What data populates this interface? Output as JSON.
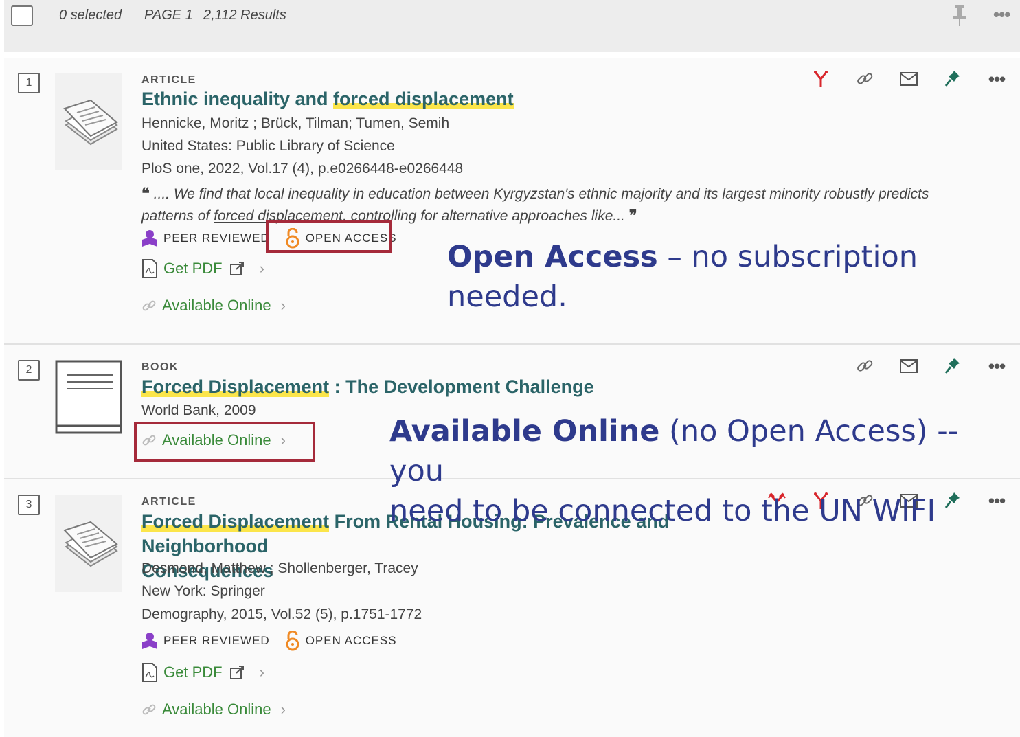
{
  "toolbar": {
    "selected": "0 selected",
    "page": "PAGE 1",
    "results": "2,112 Results"
  },
  "records": [
    {
      "num": "1",
      "type": "ARTICLE",
      "title_hl": "forced displacement",
      "title_plain": "Ethnic inequality and ",
      "authors": "Hennicke, Moritz ; Brück, Tilman; Tumen, Semih",
      "publisher": "United States: Public Library of Science",
      "source": "PloS one, 2022, Vol.17 (4), p.e0266448-e0266448",
      "snippet_a": " .... We find that local inequality in education between Kyrgyzstan's ethnic majority and its largest minority robustly predicts patterns of ",
      "snippet_hl": "forced displacement",
      "snippet_b": ", controlling for alternative approaches like... ",
      "peer": "PEER REVIEWED",
      "oa": "OPEN ACCESS",
      "pdf": "Get PDF",
      "online": "Available Online"
    },
    {
      "num": "2",
      "type": "BOOK",
      "title_hl": "Forced Displacement",
      "title_plain": " : The Development Challenge",
      "publisher": "World Bank, 2009",
      "online": "Available Online"
    },
    {
      "num": "3",
      "type": "ARTICLE",
      "title_hl": "Forced Displacement",
      "title_plain": " From Rental Housing: Prevalence and Neighborhood",
      "title_line2": "Consequences",
      "authors": "Desmond, Matthew ; Shollenberger, Tracey",
      "publisher": "New York: Springer",
      "source": "Demography, 2015, Vol.52 (5), p.1751-1772",
      "peer": "PEER REVIEWED",
      "oa": "OPEN ACCESS",
      "pdf": "Get PDF",
      "online": "Available Online"
    }
  ],
  "annotations": {
    "oa_bold": "Open Access",
    "oa_rest": " – no subscription",
    "oa_line2": "needed.",
    "ao_bold": "Available Online",
    "ao_rest": " (no Open Access) -- you",
    "ao_line2": "need to be connected to the UN WIFI"
  },
  "icons": [
    "citation-trail-icon",
    "link-icon",
    "email-icon",
    "pin-icon",
    "more-icon",
    "pdf-icon",
    "external-link-icon",
    "peer-reviewed-icon",
    "open-access-lock-icon",
    "sources-icon"
  ],
  "colors": {
    "title": "#2b6468",
    "link": "#3a8a3a",
    "highlight": "#fbe54a",
    "redbox": "#a52a3a",
    "annotation": "#2e3a8c"
  }
}
